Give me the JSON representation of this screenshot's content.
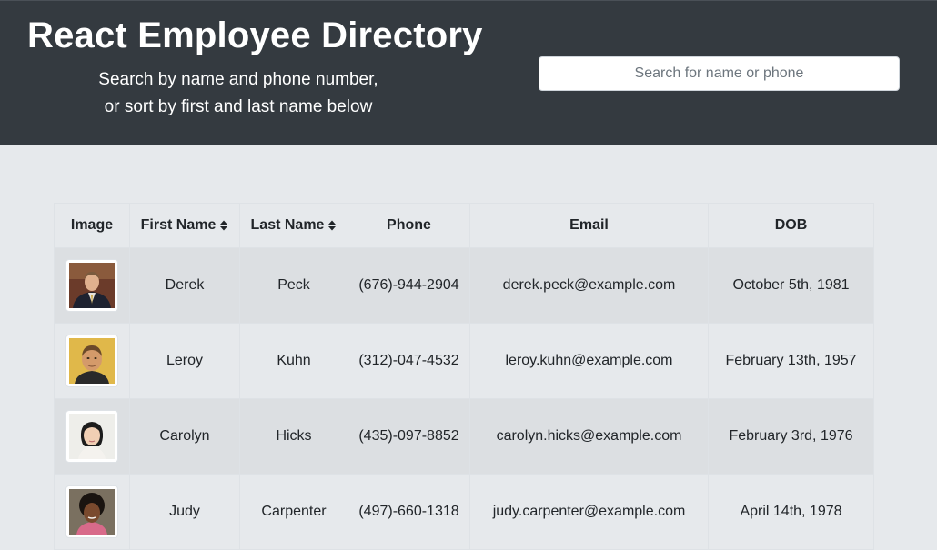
{
  "header": {
    "title": "React Employee Directory",
    "subtitle_line1": "Search by name and phone number,",
    "subtitle_line2": "or sort by first and last name below",
    "search_placeholder": "Search for name or phone"
  },
  "table": {
    "columns": {
      "image": "Image",
      "first_name": "First Name",
      "last_name": "Last Name",
      "phone": "Phone",
      "email": "Email",
      "dob": "DOB"
    },
    "sort_icon": "sort-both-icon",
    "rows": [
      {
        "first": "Derek",
        "last": "Peck",
        "phone": "(676)-944-2904",
        "email": "derek.peck@example.com",
        "dob": "October 5th, 1981",
        "avatar": "man-in-suit-photo"
      },
      {
        "first": "Leroy",
        "last": "Kuhn",
        "phone": "(312)-047-4532",
        "email": "leroy.kuhn@example.com",
        "dob": "February 13th, 1957",
        "avatar": "man-photo"
      },
      {
        "first": "Carolyn",
        "last": "Hicks",
        "phone": "(435)-097-8852",
        "email": "carolyn.hicks@example.com",
        "dob": "February 3rd, 1976",
        "avatar": "woman-photo"
      },
      {
        "first": "Judy",
        "last": "Carpenter",
        "phone": "(497)-660-1318",
        "email": "judy.carpenter@example.com",
        "dob": "April 14th, 1978",
        "avatar": "woman-curly-hair-photo"
      }
    ]
  },
  "colors": {
    "header_bg": "#343a40",
    "page_bg": "#e6e9ec",
    "striped_row_bg": "#dcdfe2"
  }
}
